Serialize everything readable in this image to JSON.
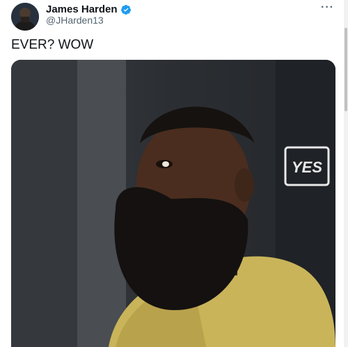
{
  "author": {
    "display_name": "James Harden",
    "handle": "@JHarden13",
    "verified": true
  },
  "tweet": {
    "text": "EVER? WOW"
  },
  "media": {
    "watermark_text": "YES"
  },
  "icons": {
    "verified": "verified-badge-icon",
    "more": "more-options-icon"
  },
  "colors": {
    "verified": "#1d9bf0",
    "handle": "#536471"
  }
}
